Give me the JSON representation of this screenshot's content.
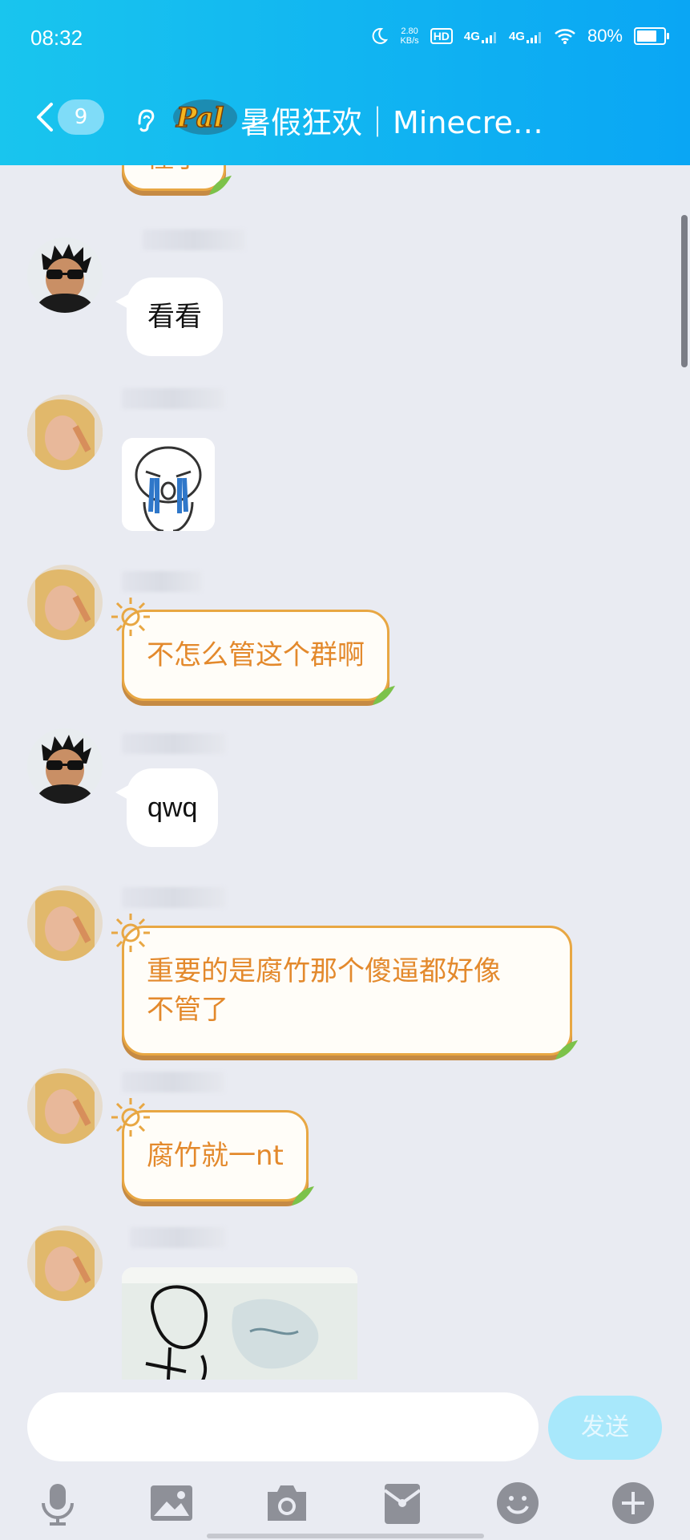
{
  "status_bar": {
    "time": "08:32",
    "net_speed": "2.80",
    "net_unit": "KB/s",
    "hd": "HD",
    "sim1": "4G",
    "sim2": "4G",
    "battery": "80%"
  },
  "header": {
    "unread_count": "9",
    "logo_text": "Pal",
    "group_title": "暑假狂欢｜Minecre…"
  },
  "messages": [
    {
      "sender": "blurred",
      "avatar": "sunglasses-avatar",
      "type": "text",
      "text": "看看"
    },
    {
      "sender": "blurred",
      "avatar": "blonde-avatar",
      "type": "sticker",
      "sticker": "crying-face-sticker"
    },
    {
      "sender": "blurred",
      "avatar": "blonde-avatar",
      "type": "text-styled",
      "text": "不怎么管这个群啊"
    },
    {
      "sender": "blurred",
      "avatar": "sunglasses-avatar",
      "type": "text",
      "text": "qwq"
    },
    {
      "sender": "blurred",
      "avatar": "blonde-avatar",
      "type": "text-styled",
      "text_line1": "重要的是腐竹那个傻逼都好像",
      "text_line2": "不管了"
    },
    {
      "sender": "blurred",
      "avatar": "blonde-avatar",
      "type": "text-styled",
      "text": "腐竹就一nt"
    },
    {
      "sender": "blurred",
      "avatar": "blonde-avatar",
      "type": "image",
      "image": "sketch-image"
    }
  ],
  "partial_top": {
    "text": "懂了"
  },
  "composer": {
    "placeholder": "",
    "send_label": "发送"
  },
  "toolbar": [
    "microphone-icon",
    "image-icon",
    "camera-icon",
    "red-packet-icon",
    "emoji-icon",
    "plus-icon"
  ],
  "colors": {
    "header_start": "#19c5ee",
    "header_end": "#0aa6f4",
    "bubble_orange": "#e3892c",
    "send_disabled": "#a8e8fb"
  }
}
